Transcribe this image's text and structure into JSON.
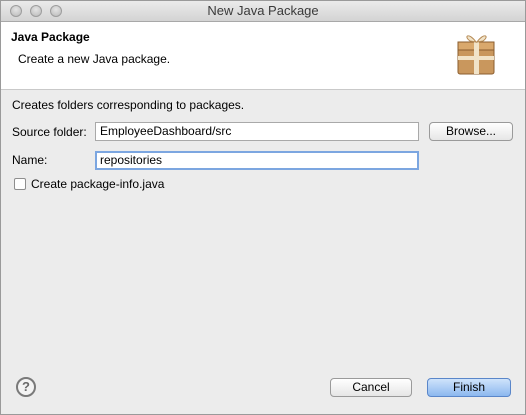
{
  "window": {
    "title": "New Java Package"
  },
  "banner": {
    "title": "Java Package",
    "description": "Create a new Java package."
  },
  "form": {
    "intro": "Creates folders corresponding to packages.",
    "source_folder_label": "Source folder:",
    "source_folder_value": "EmployeeDashboard/src",
    "browse_label": "Browse...",
    "name_label": "Name:",
    "name_value": "repositories",
    "package_info_label": "Create package-info.java",
    "package_info_checked": false
  },
  "footer": {
    "help_glyph": "?",
    "cancel_label": "Cancel",
    "finish_label": "Finish"
  },
  "icons": {
    "help": "help-icon",
    "package": "package-icon"
  },
  "colors": {
    "accent": "#7ca6e0",
    "default_button": "#8cb8ef"
  }
}
